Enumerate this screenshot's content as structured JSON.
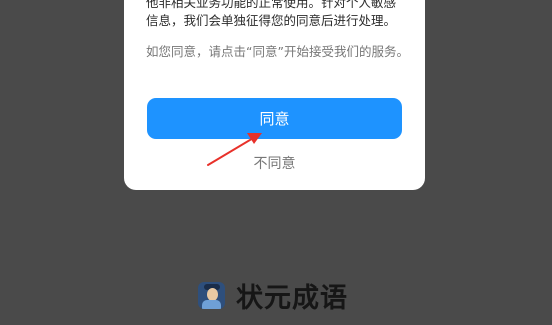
{
  "dialog": {
    "partial_top_line": "他非相关业务功能的正常使用。针对个人敏感",
    "body_line": "信息，我们会单独征得您的同意后进行处理。",
    "hint_text": "如您同意，请点击“同意”开始接受我们的服务。",
    "agree_label": "同意",
    "disagree_label": "不同意"
  },
  "brand": {
    "app_name": "状元成语",
    "icon": "scholar-app-icon"
  },
  "colors": {
    "overlay": "#4a4a4a",
    "primary_button": "#1e93ff",
    "annotation_arrow": "#e8312a"
  }
}
